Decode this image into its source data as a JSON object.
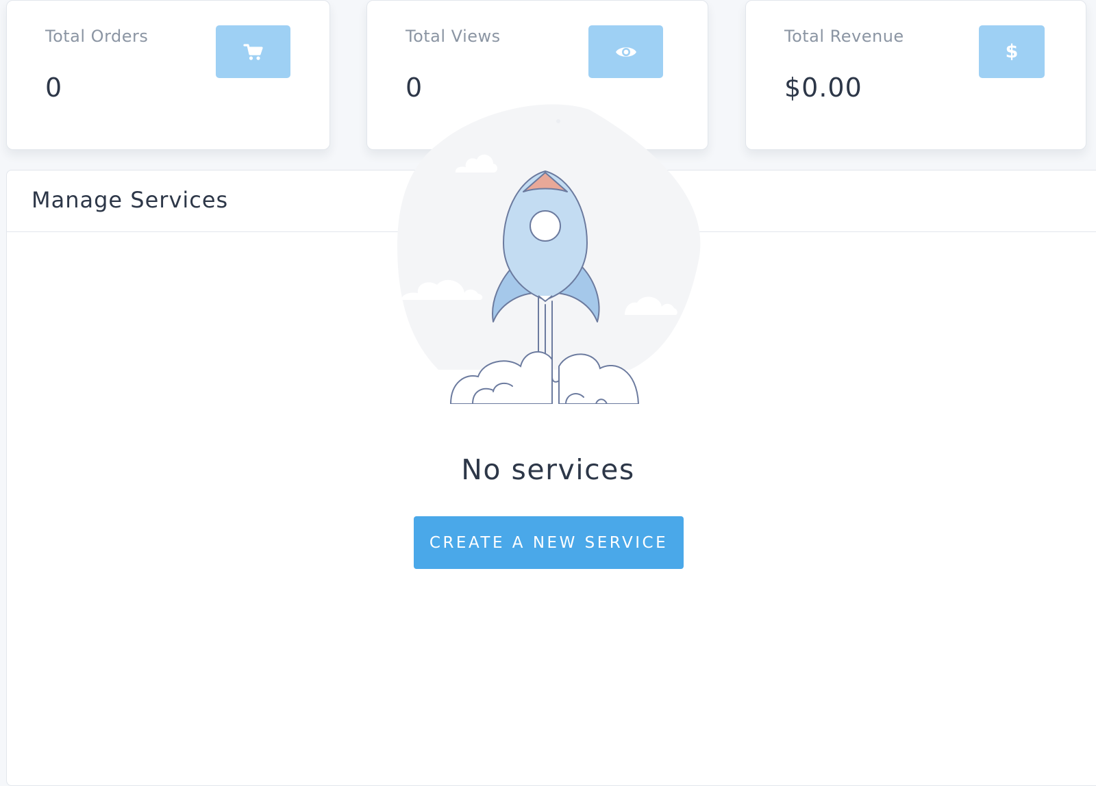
{
  "stats": [
    {
      "label": "Total Orders",
      "value": "0",
      "icon": "shopping-cart-icon"
    },
    {
      "label": "Total Views",
      "value": "0",
      "icon": "eye-icon"
    },
    {
      "label": "Total Revenue",
      "value": "$0.00",
      "icon": "dollar-icon",
      "icon_glyph": "$"
    }
  ],
  "services_panel": {
    "title": "Manage Services",
    "empty_title": "No services",
    "create_button_label": "CREATE A NEW SERVICE",
    "illustration": "rocket-launch-illustration"
  },
  "colors": {
    "icon_box": "#9ed0f4",
    "primary_button": "#4aa8e9",
    "rocket_body": "#c3dcf2",
    "rocket_fins": "#a5c8ea",
    "rocket_tip": "#e8a898",
    "outline": "#6b7a9e"
  }
}
